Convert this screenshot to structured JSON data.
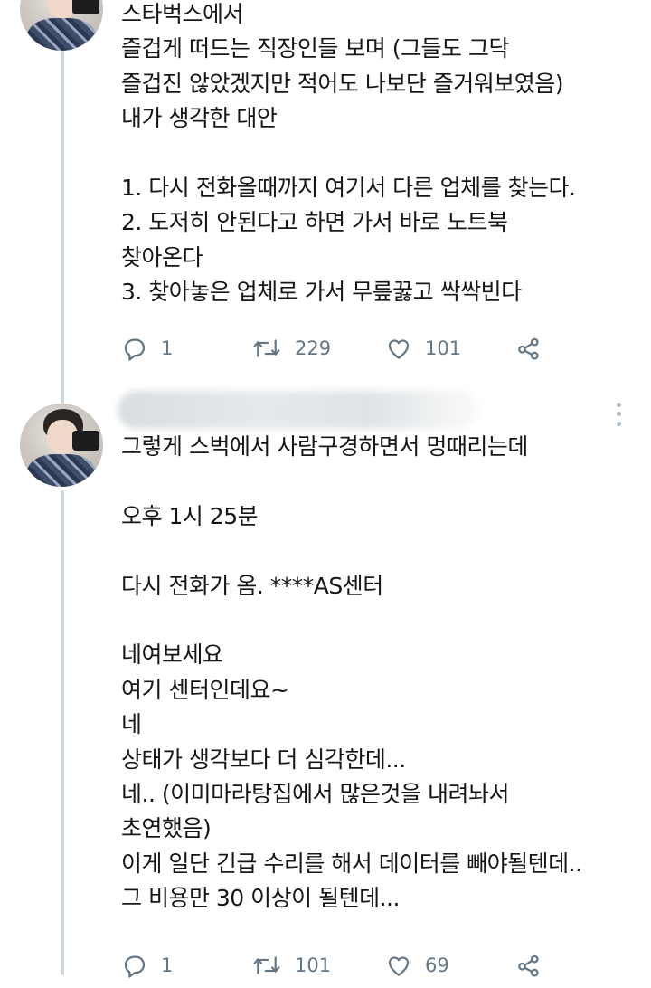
{
  "tweets": [
    {
      "lines": [
        "스타벅스에서",
        "즐겁게 떠드는 직장인들 보며 (그들도 그닥",
        "즐겁진 않았겠지만 적어도 나보단 즐거워보였음)",
        "내가 생각한 대안",
        "",
        "1. 다시 전화올때까지 여기서 다른 업체를 찾는다.",
        "2. 도저히 안된다고 하면 가서 바로 노트북",
        "찾아온다",
        "3. 찾아놓은 업체로 가서 무릎꿇고 싹싹빈다"
      ],
      "reply_count": "1",
      "retweet_count": "229",
      "like_count": "101"
    },
    {
      "lines": [
        "그렇게 스벅에서 사람구경하면서 멍때리는데",
        "",
        "오후 1시 25분",
        "",
        "다시 전화가 옴. ****AS센터",
        "",
        "네여보세요",
        "여기 센터인데요~",
        "네",
        "상태가 생각보다 더 심각한데...",
        "네.. (이미마라탕집에서 많은것을 내려놔서",
        "초연했음)",
        "이게 일단 긴급 수리를 해서 데이터를 빼야될텐데..",
        "그 비용만 30 이상이 될텐데..."
      ],
      "reply_count": "1",
      "retweet_count": "101",
      "like_count": "69"
    }
  ],
  "icons": {
    "reply": "reply-icon",
    "retweet": "retweet-icon",
    "like": "heart-icon",
    "share": "share-icon",
    "more": "more-vertical-icon"
  },
  "colors": {
    "text": "#14171a",
    "icon_gray": "#657786",
    "thread_line": "#ccd6dd"
  }
}
